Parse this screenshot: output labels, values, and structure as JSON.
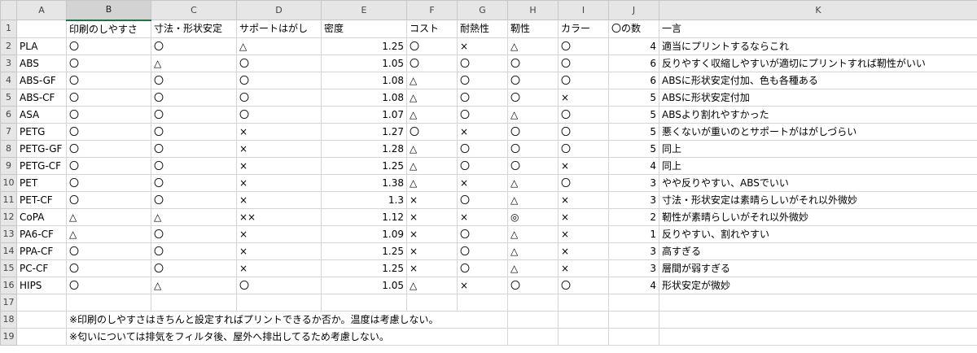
{
  "columns": [
    "A",
    "B",
    "C",
    "D",
    "E",
    "F",
    "G",
    "H",
    "I",
    "J",
    "K"
  ],
  "header": {
    "b": "印刷のしやすさ",
    "c": "寸法・形状安定",
    "d": "サポートはがし",
    "e": "密度",
    "f": "コスト",
    "g": "耐熱性",
    "h": "靭性",
    "i": "カラー",
    "j": "〇の数",
    "k": "一言"
  },
  "rows": [
    {
      "a": "PLA",
      "b": "〇",
      "c": "〇",
      "d": "△",
      "e": "1.25",
      "f": "〇",
      "g": "×",
      "h": "△",
      "i": "〇",
      "j": "4",
      "k": "適当にプリントするならこれ"
    },
    {
      "a": "ABS",
      "b": "〇",
      "c": "△",
      "d": "〇",
      "e": "1.05",
      "f": "〇",
      "g": "〇",
      "h": "〇",
      "i": "〇",
      "j": "6",
      "k": "反りやすく収縮しやすいが適切にプリントすれば靭性がいい"
    },
    {
      "a": "ABS-GF",
      "b": "〇",
      "c": "〇",
      "d": "〇",
      "e": "1.08",
      "f": "△",
      "g": "〇",
      "h": "〇",
      "i": "〇",
      "j": "6",
      "k": "ABSに形状安定付加、色も各種ある"
    },
    {
      "a": "ABS-CF",
      "b": "〇",
      "c": "〇",
      "d": "〇",
      "e": "1.08",
      "f": "△",
      "g": "〇",
      "h": "〇",
      "i": "×",
      "j": "5",
      "k": "ABSに形状安定付加"
    },
    {
      "a": "ASA",
      "b": "〇",
      "c": "〇",
      "d": "〇",
      "e": "1.07",
      "f": "△",
      "g": "〇",
      "h": "△",
      "i": "〇",
      "j": "5",
      "k": "ABSより割れやすかった"
    },
    {
      "a": "PETG",
      "b": "〇",
      "c": "〇",
      "d": "×",
      "e": "1.27",
      "f": "〇",
      "g": "×",
      "h": "〇",
      "i": "〇",
      "j": "5",
      "k": "悪くないが重いのとサポートがはがしづらい"
    },
    {
      "a": "PETG-GF",
      "b": "〇",
      "c": "〇",
      "d": "×",
      "e": "1.28",
      "f": "△",
      "g": "〇",
      "h": "〇",
      "i": "〇",
      "j": "5",
      "k": "同上"
    },
    {
      "a": "PETG-CF",
      "b": "〇",
      "c": "〇",
      "d": "×",
      "e": "1.25",
      "f": "△",
      "g": "〇",
      "h": "〇",
      "i": "×",
      "j": "4",
      "k": "同上"
    },
    {
      "a": "PET",
      "b": "〇",
      "c": "〇",
      "d": "×",
      "e": "1.38",
      "f": "△",
      "g": "×",
      "h": "△",
      "i": "〇",
      "j": "3",
      "k": "やや反りやすい、ABSでいい"
    },
    {
      "a": "PET-CF",
      "b": "〇",
      "c": "〇",
      "d": "×",
      "e": "1.3",
      "f": "×",
      "g": "〇",
      "h": "△",
      "i": "×",
      "j": "3",
      "k": "寸法・形状安定は素晴らしいがそれ以外微妙"
    },
    {
      "a": "CoPA",
      "b": "△",
      "c": "△",
      "d": "××",
      "e": "1.12",
      "f": "×",
      "g": "×",
      "h": "◎",
      "i": "×",
      "j": "2",
      "k": "靭性が素晴らしいがそれ以外微妙"
    },
    {
      "a": "PA6-CF",
      "b": "△",
      "c": "〇",
      "d": "×",
      "e": "1.09",
      "f": "×",
      "g": "〇",
      "h": "△",
      "i": "×",
      "j": "1",
      "k": "反りやすい、割れやすい"
    },
    {
      "a": "PPA-CF",
      "b": "〇",
      "c": "〇",
      "d": "×",
      "e": "1.25",
      "f": "×",
      "g": "〇",
      "h": "△",
      "i": "×",
      "j": "3",
      "k": "高すぎる"
    },
    {
      "a": "PC-CF",
      "b": "〇",
      "c": "〇",
      "d": "×",
      "e": "1.25",
      "f": "×",
      "g": "〇",
      "h": "△",
      "i": "×",
      "j": "3",
      "k": "層間が弱すぎる"
    },
    {
      "a": "HIPS",
      "b": "〇",
      "c": "△",
      "d": "〇",
      "e": "1.05",
      "f": "△",
      "g": "×",
      "h": "〇",
      "i": "〇",
      "j": "4",
      "k": "形状安定が微妙"
    }
  ],
  "notes": [
    "※印刷のしやすさはきちんと設定すればプリントできるか否か。温度は考慮しない。",
    "※匂いについては排気をフィルタ後、屋外へ排出してるため考慮しない。"
  ],
  "colors": {
    "header_bg": "#e6e6e6",
    "selection_green": "#217346",
    "gridline": "#d4d4d4"
  }
}
